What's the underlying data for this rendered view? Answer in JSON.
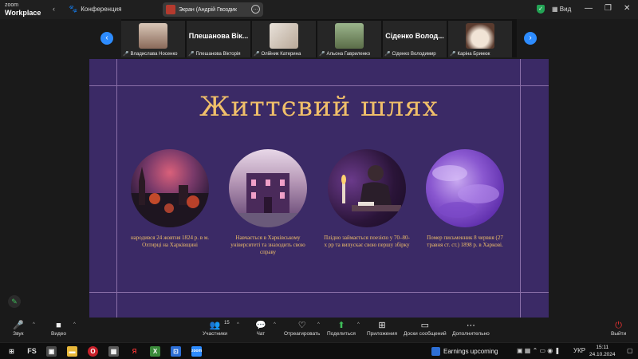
{
  "titlebar": {
    "logo_line1": "zoom",
    "logo_line2": "Workplace",
    "conference_label": "Конференция",
    "screen_share_label": "Экран (Андрій Гвоздик",
    "view_label": "Вид"
  },
  "participants": [
    {
      "name": "Владислава Носенко",
      "big_name": ""
    },
    {
      "name": "Плешанова Вікторія",
      "big_name": "Плешанова Вік..."
    },
    {
      "name": "Олійник Катерина",
      "big_name": ""
    },
    {
      "name": "Альона Гавриленко",
      "big_name": ""
    },
    {
      "name": "Сіденко Володимир",
      "big_name": "Сіденко Волод..."
    },
    {
      "name": "Каріна Бринюк",
      "big_name": ""
    }
  ],
  "slide": {
    "title": "Життєвий шлях",
    "items": [
      {
        "caption": "народився 24 жовтня 1824 р. в м. Охтирці на Харківщині",
        "image": "town-at-sunset"
      },
      {
        "caption": "Навчається в Харківському університеті та знаходить свою справу",
        "image": "university-building"
      },
      {
        "caption": "Плідно займається поезією у 70–80-х рр та випускає свою першу збірку",
        "image": "poet-writing-by-candle"
      },
      {
        "caption": "Помер письменник 8 червня (27 травня ст. ст.) 1898 р. в Харкові.",
        "image": "purple-clouds"
      }
    ]
  },
  "toolbar": {
    "audio": "Звук",
    "video": "Видео",
    "participants": "Участники",
    "participants_count": "15",
    "chat": "Чат",
    "react": "Отреагировать",
    "share": "Поделиться",
    "apps": "Приложения",
    "whiteboards": "Доски сообщений",
    "more": "Дополнительно",
    "leave": "Выйти"
  },
  "taskbar": {
    "notification": "Earnings upcoming",
    "lang": "УКР",
    "time": "15:11",
    "date": "24.10.2024"
  },
  "colors": {
    "slide_bg": "#3b2a66",
    "slide_gold": "#f0bf6a",
    "zoom_blue": "#2d8cff",
    "mute_red": "#e33333"
  }
}
